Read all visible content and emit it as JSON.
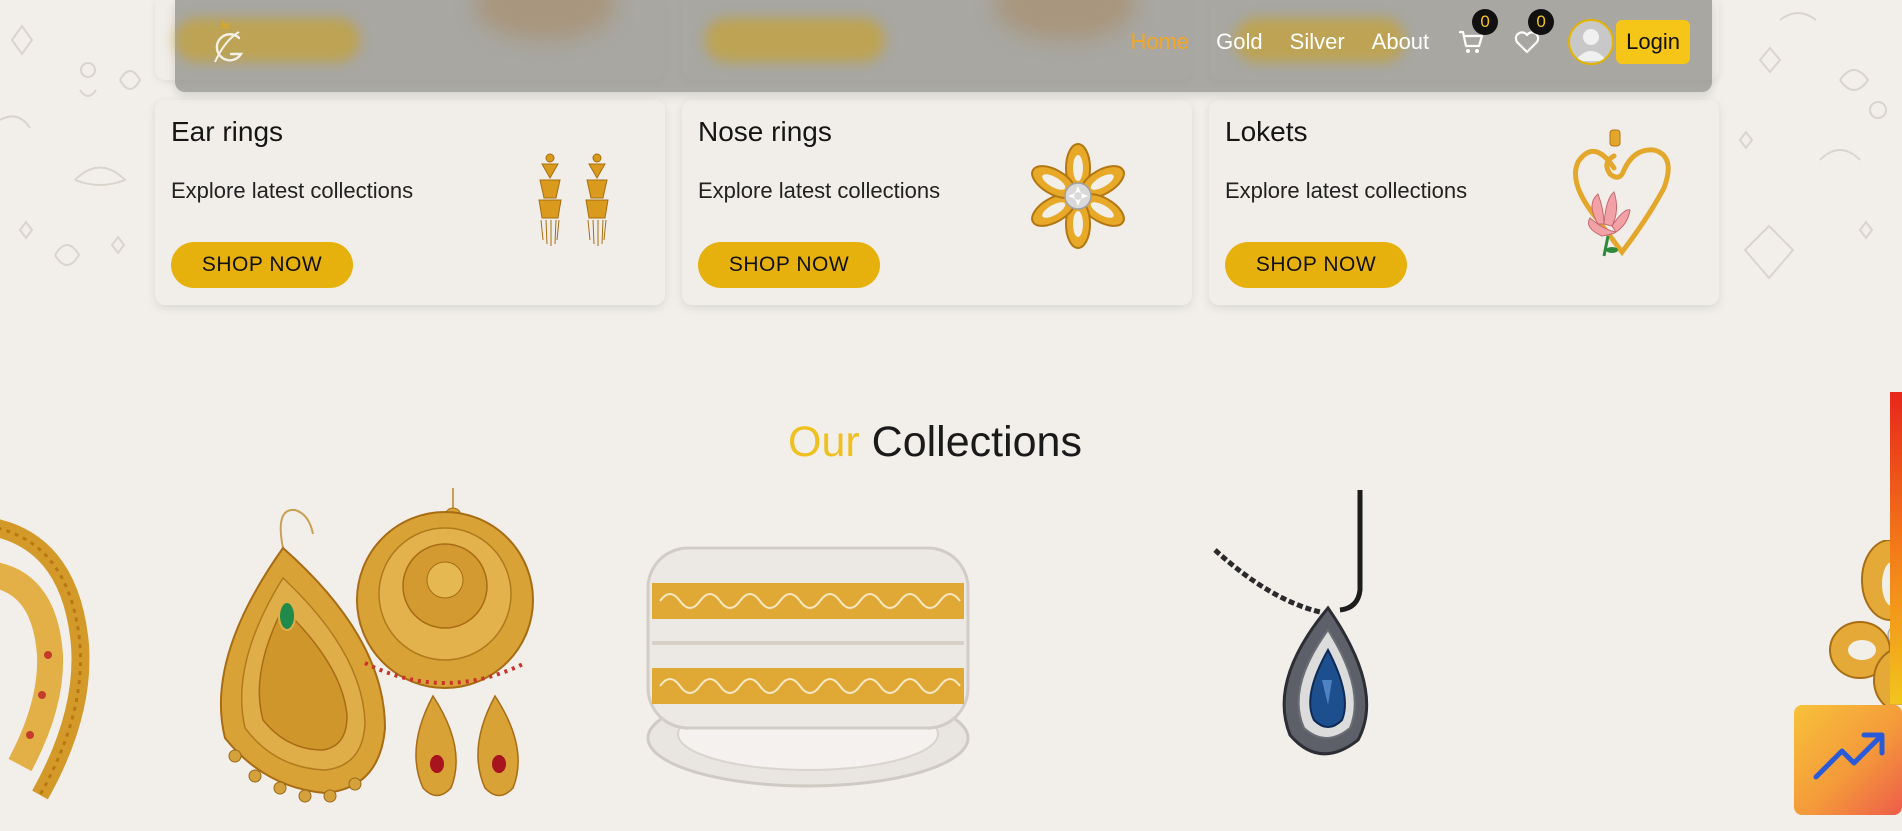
{
  "nav": {
    "links": [
      {
        "label": "Home",
        "active": true
      },
      {
        "label": "Gold",
        "active": false
      },
      {
        "label": "Silver",
        "active": false
      },
      {
        "label": "About",
        "active": false
      }
    ],
    "cart_count": "0",
    "wishlist_count": "0",
    "login_label": "Login",
    "icons": [
      "logo",
      "cart-icon",
      "heart-icon",
      "avatar"
    ]
  },
  "categories": [
    {
      "title": "Ear rings",
      "subtitle": "Explore latest collections",
      "button": "SHOP NOW",
      "image": "earrings"
    },
    {
      "title": "Nose rings",
      "subtitle": "Explore latest collections",
      "button": "SHOP NOW",
      "image": "flower-nose-ring"
    },
    {
      "title": "Lokets",
      "subtitle": "Explore latest collections",
      "button": "SHOP NOW",
      "image": "heart-locket"
    }
  ],
  "collections": {
    "heading_accent": "Our",
    "heading_rest": "Collections",
    "products": [
      "gold-necklace-partial",
      "gold-earring-set",
      "gold-bangles",
      "sapphire-pendant",
      "gold-flower-partial"
    ]
  },
  "colors": {
    "accent": "#f5c518",
    "button": "#e7b10d",
    "active_link": "#f6a623",
    "background": "#f2efea"
  }
}
